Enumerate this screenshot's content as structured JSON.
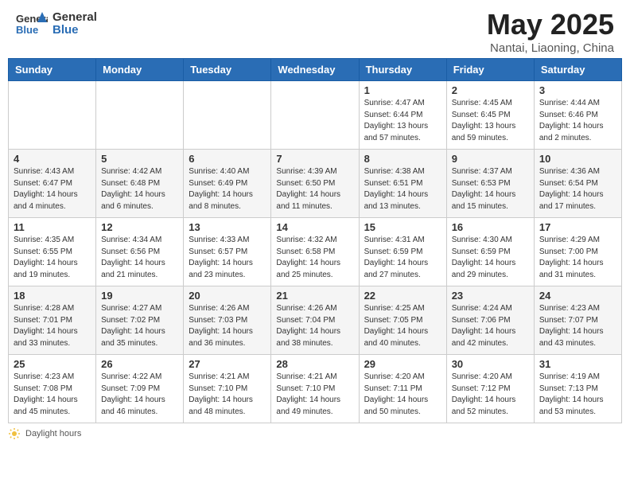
{
  "header": {
    "logo_general": "General",
    "logo_blue": "Blue",
    "title": "May 2025",
    "subtitle": "Nantai, Liaoning, China"
  },
  "days_of_week": [
    "Sunday",
    "Monday",
    "Tuesday",
    "Wednesday",
    "Thursday",
    "Friday",
    "Saturday"
  ],
  "weeks": [
    {
      "days": [
        {
          "num": "",
          "info": ""
        },
        {
          "num": "",
          "info": ""
        },
        {
          "num": "",
          "info": ""
        },
        {
          "num": "",
          "info": ""
        },
        {
          "num": "1",
          "info": "Sunrise: 4:47 AM\nSunset: 6:44 PM\nDaylight: 13 hours and 57 minutes."
        },
        {
          "num": "2",
          "info": "Sunrise: 4:45 AM\nSunset: 6:45 PM\nDaylight: 13 hours and 59 minutes."
        },
        {
          "num": "3",
          "info": "Sunrise: 4:44 AM\nSunset: 6:46 PM\nDaylight: 14 hours and 2 minutes."
        }
      ]
    },
    {
      "days": [
        {
          "num": "4",
          "info": "Sunrise: 4:43 AM\nSunset: 6:47 PM\nDaylight: 14 hours and 4 minutes."
        },
        {
          "num": "5",
          "info": "Sunrise: 4:42 AM\nSunset: 6:48 PM\nDaylight: 14 hours and 6 minutes."
        },
        {
          "num": "6",
          "info": "Sunrise: 4:40 AM\nSunset: 6:49 PM\nDaylight: 14 hours and 8 minutes."
        },
        {
          "num": "7",
          "info": "Sunrise: 4:39 AM\nSunset: 6:50 PM\nDaylight: 14 hours and 11 minutes."
        },
        {
          "num": "8",
          "info": "Sunrise: 4:38 AM\nSunset: 6:51 PM\nDaylight: 14 hours and 13 minutes."
        },
        {
          "num": "9",
          "info": "Sunrise: 4:37 AM\nSunset: 6:53 PM\nDaylight: 14 hours and 15 minutes."
        },
        {
          "num": "10",
          "info": "Sunrise: 4:36 AM\nSunset: 6:54 PM\nDaylight: 14 hours and 17 minutes."
        }
      ]
    },
    {
      "days": [
        {
          "num": "11",
          "info": "Sunrise: 4:35 AM\nSunset: 6:55 PM\nDaylight: 14 hours and 19 minutes."
        },
        {
          "num": "12",
          "info": "Sunrise: 4:34 AM\nSunset: 6:56 PM\nDaylight: 14 hours and 21 minutes."
        },
        {
          "num": "13",
          "info": "Sunrise: 4:33 AM\nSunset: 6:57 PM\nDaylight: 14 hours and 23 minutes."
        },
        {
          "num": "14",
          "info": "Sunrise: 4:32 AM\nSunset: 6:58 PM\nDaylight: 14 hours and 25 minutes."
        },
        {
          "num": "15",
          "info": "Sunrise: 4:31 AM\nSunset: 6:59 PM\nDaylight: 14 hours and 27 minutes."
        },
        {
          "num": "16",
          "info": "Sunrise: 4:30 AM\nSunset: 6:59 PM\nDaylight: 14 hours and 29 minutes."
        },
        {
          "num": "17",
          "info": "Sunrise: 4:29 AM\nSunset: 7:00 PM\nDaylight: 14 hours and 31 minutes."
        }
      ]
    },
    {
      "days": [
        {
          "num": "18",
          "info": "Sunrise: 4:28 AM\nSunset: 7:01 PM\nDaylight: 14 hours and 33 minutes."
        },
        {
          "num": "19",
          "info": "Sunrise: 4:27 AM\nSunset: 7:02 PM\nDaylight: 14 hours and 35 minutes."
        },
        {
          "num": "20",
          "info": "Sunrise: 4:26 AM\nSunset: 7:03 PM\nDaylight: 14 hours and 36 minutes."
        },
        {
          "num": "21",
          "info": "Sunrise: 4:26 AM\nSunset: 7:04 PM\nDaylight: 14 hours and 38 minutes."
        },
        {
          "num": "22",
          "info": "Sunrise: 4:25 AM\nSunset: 7:05 PM\nDaylight: 14 hours and 40 minutes."
        },
        {
          "num": "23",
          "info": "Sunrise: 4:24 AM\nSunset: 7:06 PM\nDaylight: 14 hours and 42 minutes."
        },
        {
          "num": "24",
          "info": "Sunrise: 4:23 AM\nSunset: 7:07 PM\nDaylight: 14 hours and 43 minutes."
        }
      ]
    },
    {
      "days": [
        {
          "num": "25",
          "info": "Sunrise: 4:23 AM\nSunset: 7:08 PM\nDaylight: 14 hours and 45 minutes."
        },
        {
          "num": "26",
          "info": "Sunrise: 4:22 AM\nSunset: 7:09 PM\nDaylight: 14 hours and 46 minutes."
        },
        {
          "num": "27",
          "info": "Sunrise: 4:21 AM\nSunset: 7:10 PM\nDaylight: 14 hours and 48 minutes."
        },
        {
          "num": "28",
          "info": "Sunrise: 4:21 AM\nSunset: 7:10 PM\nDaylight: 14 hours and 49 minutes."
        },
        {
          "num": "29",
          "info": "Sunrise: 4:20 AM\nSunset: 7:11 PM\nDaylight: 14 hours and 50 minutes."
        },
        {
          "num": "30",
          "info": "Sunrise: 4:20 AM\nSunset: 7:12 PM\nDaylight: 14 hours and 52 minutes."
        },
        {
          "num": "31",
          "info": "Sunrise: 4:19 AM\nSunset: 7:13 PM\nDaylight: 14 hours and 53 minutes."
        }
      ]
    }
  ],
  "footer": {
    "daylight_hours_label": "Daylight hours"
  }
}
